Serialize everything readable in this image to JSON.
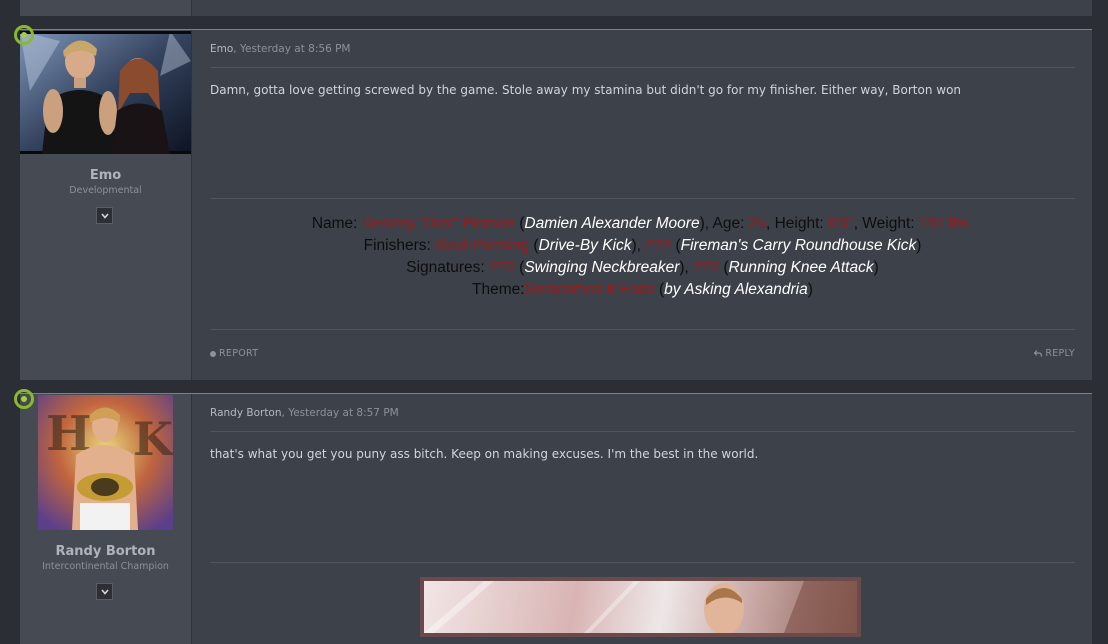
{
  "posts": [
    {
      "author": "Emo",
      "time": "Yesterday at 8:56 PM",
      "user_title": "Developmental",
      "message": "Damn, gotta love getting screwed by the game. Stole away my stamina but didn't go for my finisher. Either way, Borton won",
      "signature": {
        "line1": {
          "name_label": "Name: ",
          "name_value": "Destery \"Des\" Pierson",
          "paren_open": " (",
          "real_name": "Damien Alexander Moore",
          "paren_close_age": "), Age: ",
          "age": "25",
          "height_label": ", Height: ",
          "height": "6'0\"",
          "weight_label": ", Weight: ",
          "weight": "197 lbs."
        },
        "line2": {
          "label": "Finishers: ",
          "finisher1": "Skull Piersing",
          "paren_open": " (",
          "finisher1_desc": "Drive-By Kick",
          "sep": "), ",
          "finisher2": "???",
          "paren_open2": " (",
          "finisher2_desc": "Fireman's Carry Roundhouse Kick",
          "paren_close": ")"
        },
        "line3": {
          "label": "Signatures: ",
          "sig1": "???",
          "paren_open": " (",
          "sig1_desc": "Swinging Neckbreaker",
          "sep": "), ",
          "sig2": "???",
          "paren_open2": " (",
          "sig2_desc": "Running Knee Attack",
          "paren_close": ")"
        },
        "line4": {
          "label": "Theme:",
          "song": "Sometimes It Ends",
          "paren_open": " (",
          "artist": "by Asking Alexandria",
          "paren_close": ")"
        }
      },
      "report_label": "REPORT",
      "reply_label": "REPLY"
    },
    {
      "author": "Randy Borton",
      "time": "Yesterday at 8:57 PM",
      "user_title": "Intercontinental Champion",
      "message": "that's what you get you puny ass bitch. Keep on making excuses. I'm the best in the world."
    }
  ],
  "colors": {
    "page_bg": "#2b2f35",
    "post_bg": "#3d424a",
    "sidebar_bg": "#454a53",
    "signature_red": "#a31617",
    "online_green": "#8ab92d"
  },
  "icons": [
    "online-indicator-icon",
    "chevron-down-icon",
    "report-icon",
    "reply-icon"
  ]
}
